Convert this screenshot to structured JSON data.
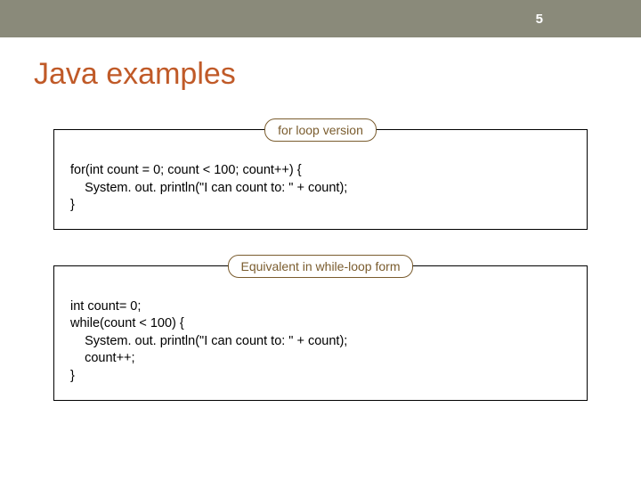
{
  "header": {
    "page_number": "5"
  },
  "title": "Java examples",
  "sections": [
    {
      "label": "for loop version",
      "code": [
        "for(int count = 0; count < 100; count++) {",
        "    System. out. println(\"I can count to: \" + count);",
        "}"
      ]
    },
    {
      "label": "Equivalent in while-loop form",
      "code": [
        "int count= 0;",
        "while(count < 100) {",
        "    System. out. println(\"I can count to: \" + count);",
        "    count++;",
        "}"
      ]
    }
  ]
}
